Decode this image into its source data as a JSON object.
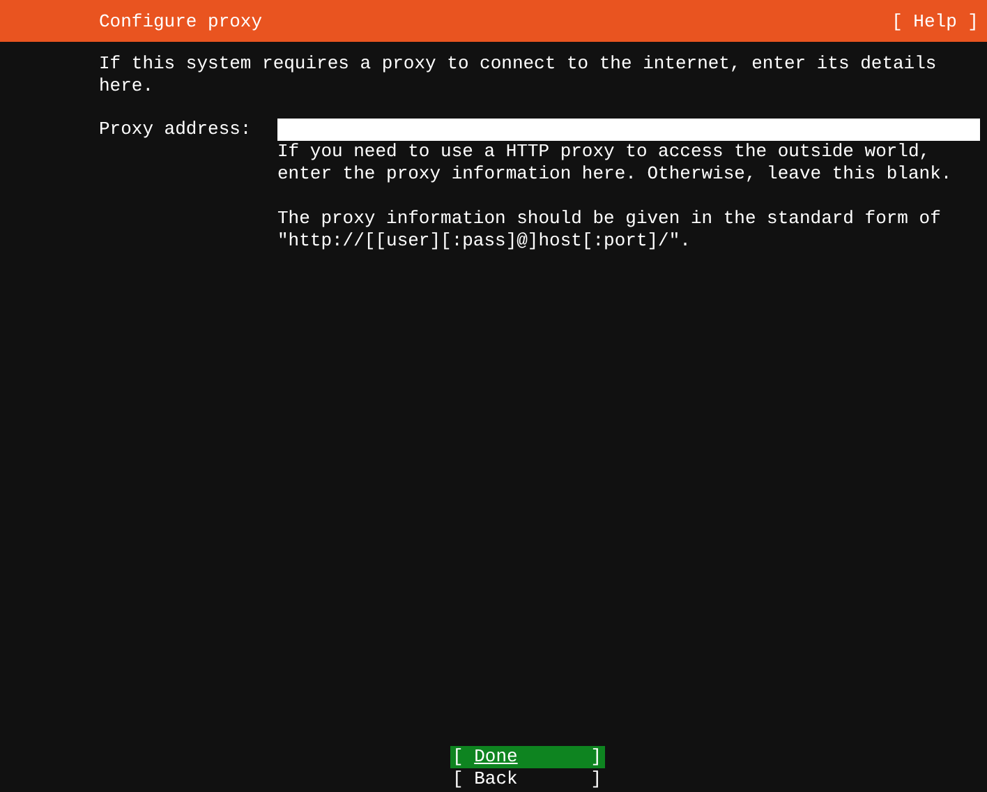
{
  "header": {
    "title": "Configure proxy",
    "help": "[ Help ]"
  },
  "intro": "If this system requires a proxy to connect to the internet, enter its details here.",
  "proxy_field": {
    "label": "Proxy address:",
    "help": [
      "If you need to use a HTTP proxy to access the outside world, enter the proxy information here. Otherwise, leave this blank.",
      "The proxy information should be given in the standard form of \"http://[[user][:pass]@]host[:port]/\"."
    ]
  },
  "buttons": [
    {
      "open": "[",
      "label": "Done",
      "close": "]",
      "selected": true
    },
    {
      "open": "[",
      "label": "Back",
      "close": "]",
      "selected": false
    }
  ]
}
